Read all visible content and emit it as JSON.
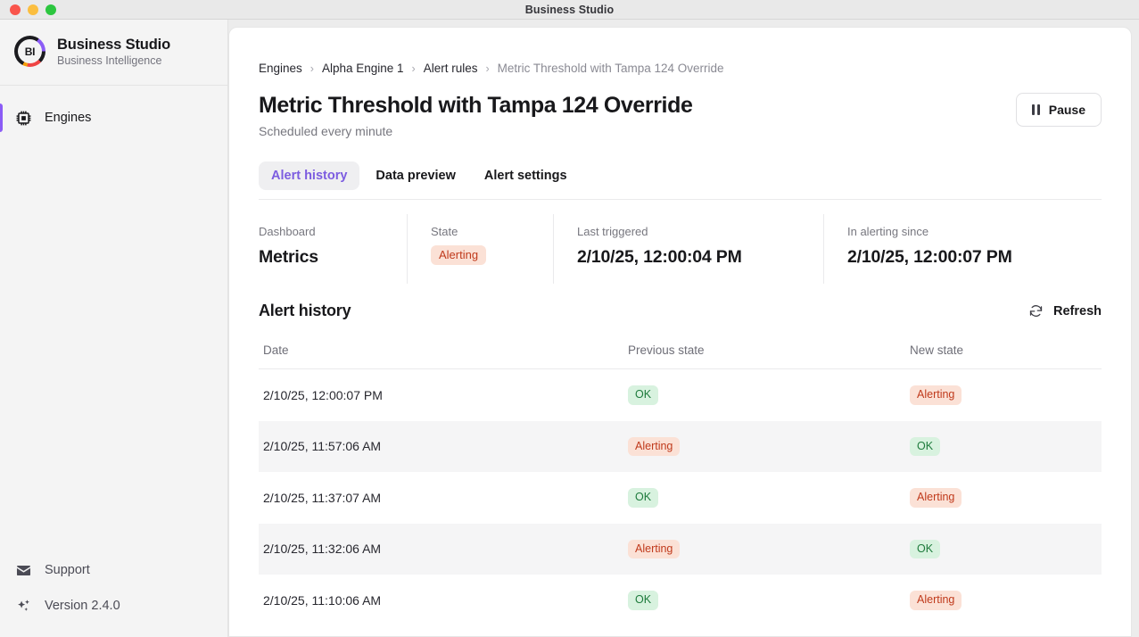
{
  "window": {
    "title": "Business Studio"
  },
  "sidebar": {
    "brand": {
      "name": "Business Studio",
      "subtitle": "Business Intelligence",
      "logo_text": "BI"
    },
    "items": [
      {
        "label": "Engines",
        "icon": "chip-icon",
        "active": true
      }
    ],
    "footer": [
      {
        "label": "Support",
        "icon": "envelope-icon"
      },
      {
        "label": "Version 2.4.0",
        "icon": "sparkles-icon"
      }
    ]
  },
  "breadcrumb": [
    {
      "label": "Engines"
    },
    {
      "label": "Alpha Engine 1"
    },
    {
      "label": "Alert rules"
    },
    {
      "label": "Metric Threshold with Tampa 124 Override"
    }
  ],
  "breadcrumb_separator": "›",
  "header": {
    "title": "Metric Threshold with Tampa 124 Override",
    "subtitle": "Scheduled every minute",
    "pause_label": "Pause"
  },
  "tabs": [
    {
      "label": "Alert history",
      "active": true
    },
    {
      "label": "Data preview",
      "active": false
    },
    {
      "label": "Alert settings",
      "active": false
    }
  ],
  "stats": [
    {
      "label": "Dashboard",
      "value": "Metrics",
      "type": "text"
    },
    {
      "label": "State",
      "value": "Alerting",
      "type": "badge",
      "badge_kind": "alerting"
    },
    {
      "label": "Last triggered",
      "value": "2/10/25, 12:00:04 PM",
      "type": "text"
    },
    {
      "label": "In alerting since",
      "value": "2/10/25, 12:00:07 PM",
      "type": "text"
    }
  ],
  "history": {
    "title": "Alert history",
    "refresh_label": "Refresh",
    "columns": [
      "Date",
      "Previous state",
      "New state"
    ],
    "rows": [
      {
        "date": "2/10/25, 12:00:07 PM",
        "previous": "OK",
        "previous_kind": "ok",
        "next": "Alerting",
        "next_kind": "alerting"
      },
      {
        "date": "2/10/25, 11:57:06 AM",
        "previous": "Alerting",
        "previous_kind": "alerting",
        "next": "OK",
        "next_kind": "ok"
      },
      {
        "date": "2/10/25, 11:37:07 AM",
        "previous": "OK",
        "previous_kind": "ok",
        "next": "Alerting",
        "next_kind": "alerting"
      },
      {
        "date": "2/10/25, 11:32:06 AM",
        "previous": "Alerting",
        "previous_kind": "alerting",
        "next": "OK",
        "next_kind": "ok"
      },
      {
        "date": "2/10/25, 11:10:06 AM",
        "previous": "OK",
        "previous_kind": "ok",
        "next": "Alerting",
        "next_kind": "alerting"
      }
    ]
  },
  "colors": {
    "accent": "#8B5CF6",
    "tab_active_text": "#7C5CE0",
    "alerting_bg": "#FBE1D6",
    "alerting_text": "#C03A1C",
    "ok_bg": "#D8F2DF",
    "ok_text": "#1E7B3C"
  }
}
